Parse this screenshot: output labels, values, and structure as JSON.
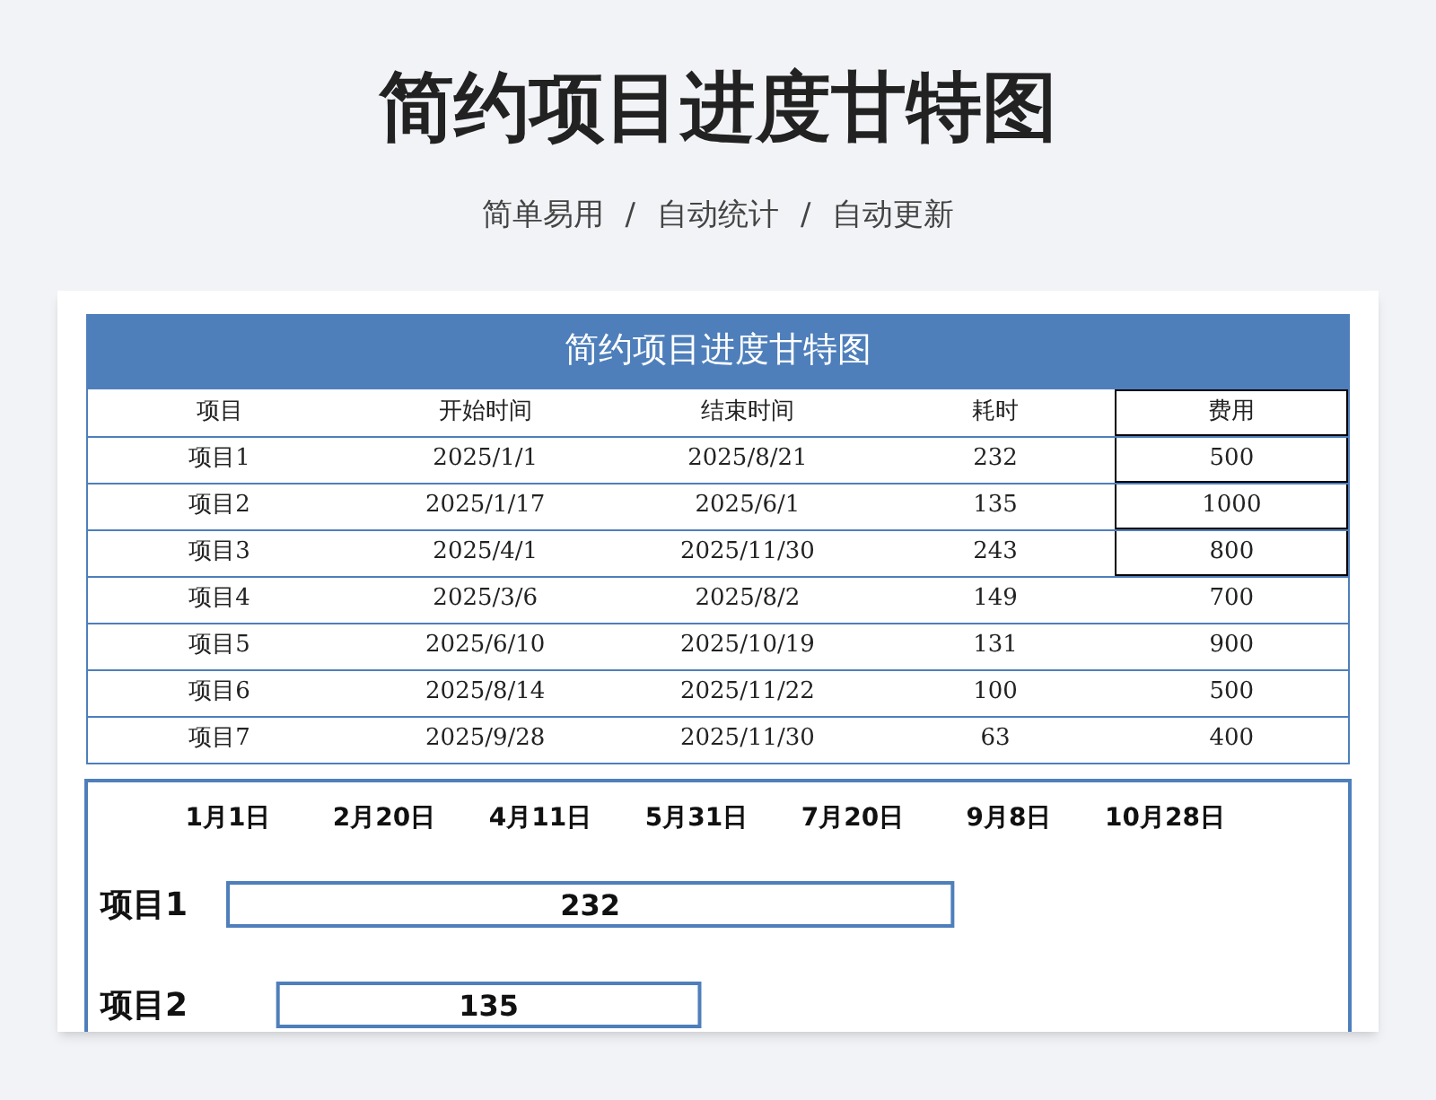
{
  "title": "简约项目进度甘特图",
  "subtitle": [
    "简单易用",
    "自动统计",
    "自动更新"
  ],
  "separator": "/",
  "table": {
    "title": "简约项目进度甘特图",
    "columns": [
      {
        "label": "项目",
        "outlined": false
      },
      {
        "label": "开始时间",
        "outlined": false
      },
      {
        "label": "结束时间",
        "outlined": false
      },
      {
        "label": "耗时",
        "outlined": false
      },
      {
        "label": "费用",
        "outlined": true
      }
    ],
    "rows": [
      {
        "cells": [
          "项目1",
          "2025/1/1",
          "2025/8/21",
          "232",
          "500"
        ],
        "fee_outlined": true
      },
      {
        "cells": [
          "项目2",
          "2025/1/17",
          "2025/6/1",
          "135",
          "1000"
        ],
        "fee_outlined": true
      },
      {
        "cells": [
          "项目3",
          "2025/4/1",
          "2025/11/30",
          "243",
          "800"
        ],
        "fee_outlined": true
      },
      {
        "cells": [
          "项目4",
          "2025/3/6",
          "2025/8/2",
          "149",
          "700"
        ],
        "fee_outlined": false
      },
      {
        "cells": [
          "项目5",
          "2025/6/10",
          "2025/10/19",
          "131",
          "900"
        ],
        "fee_outlined": false
      },
      {
        "cells": [
          "项目6",
          "2025/8/14",
          "2025/11/22",
          "100",
          "500"
        ],
        "fee_outlined": false
      },
      {
        "cells": [
          "项目7",
          "2025/9/28",
          "2025/11/30",
          "63",
          "400"
        ],
        "fee_outlined": false
      }
    ]
  },
  "gantt": {
    "axis_labels": [
      "1月1日",
      "2月20日",
      "4月11日",
      "5月31日",
      "7月20日",
      "9月8日",
      "10月28日"
    ],
    "rows": [
      {
        "label": "项目1",
        "value": "232"
      },
      {
        "label": "项目2",
        "value": "135"
      }
    ]
  }
}
